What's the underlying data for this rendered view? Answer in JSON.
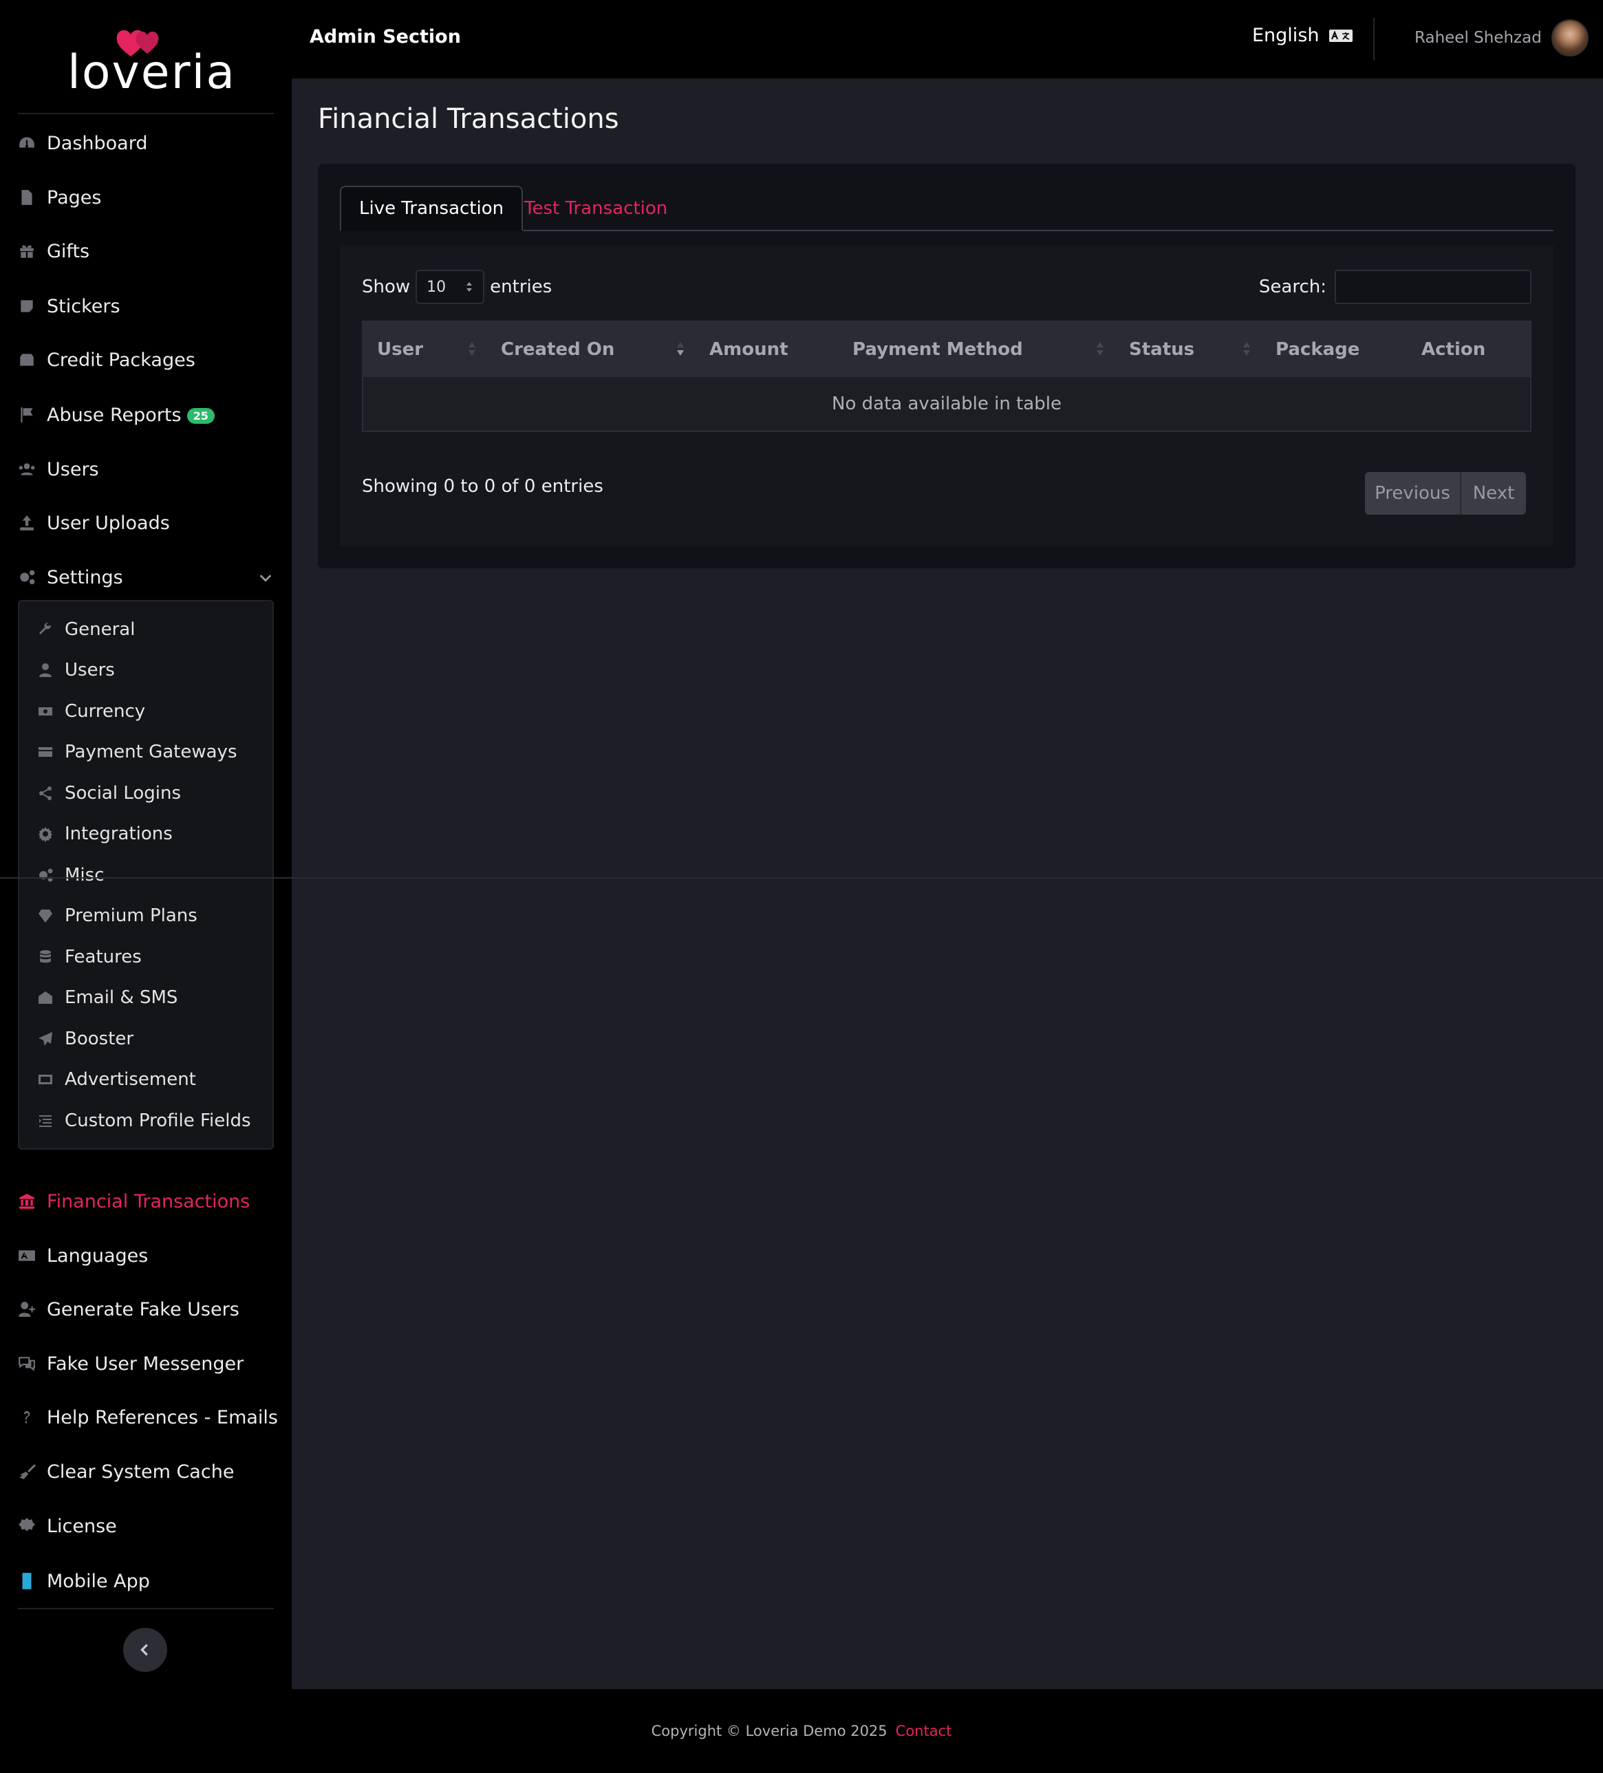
{
  "brand": {
    "name": "loveria"
  },
  "header": {
    "title": "Admin Section",
    "language": "English",
    "user_name": "Raheel Shehzad"
  },
  "sidebar": {
    "items": [
      {
        "label": "Dashboard",
        "icon": "dashboard-icon"
      },
      {
        "label": "Pages",
        "icon": "file-icon"
      },
      {
        "label": "Gifts",
        "icon": "gift-icon"
      },
      {
        "label": "Stickers",
        "icon": "sticky-note-icon"
      },
      {
        "label": "Credit Packages",
        "icon": "box-icon"
      },
      {
        "label": "Abuse Reports",
        "icon": "flag-icon",
        "badge": "25"
      },
      {
        "label": "Users",
        "icon": "users-icon"
      },
      {
        "label": "User Uploads",
        "icon": "upload-icon"
      },
      {
        "label": "Settings",
        "icon": "cogs-icon"
      }
    ],
    "settings_items": [
      {
        "label": "General",
        "icon": "wrench-icon"
      },
      {
        "label": "Users",
        "icon": "user-icon"
      },
      {
        "label": "Currency",
        "icon": "money-icon"
      },
      {
        "label": "Payment Gateways",
        "icon": "credit-card-icon"
      },
      {
        "label": "Social Logins",
        "icon": "share-icon"
      },
      {
        "label": "Integrations",
        "icon": "gear-icon"
      },
      {
        "label": "Misc",
        "icon": "cogs-icon"
      },
      {
        "label": "Premium Plans",
        "icon": "diamond-icon"
      },
      {
        "label": "Features",
        "icon": "database-icon"
      },
      {
        "label": "Email & SMS",
        "icon": "envelope-open-icon"
      },
      {
        "label": "Booster",
        "icon": "paper-plane-icon"
      },
      {
        "label": "Advertisement",
        "icon": "ad-icon"
      },
      {
        "label": "Custom Profile Fields",
        "icon": "list-icon"
      }
    ],
    "bottom_items": [
      {
        "label": "Financial Transactions",
        "icon": "bank-icon",
        "active": true
      },
      {
        "label": "Languages",
        "icon": "language-icon"
      },
      {
        "label": "Generate Fake Users",
        "icon": "user-plus-icon"
      },
      {
        "label": "Fake User Messenger",
        "icon": "comments-icon"
      },
      {
        "label": "Help References - Emails",
        "icon": "question-icon"
      },
      {
        "label": "Clear System Cache",
        "icon": "broom-icon"
      },
      {
        "label": "License",
        "icon": "certificate-icon"
      },
      {
        "label": "Mobile App",
        "icon": "mobile-icon"
      }
    ]
  },
  "main": {
    "title": "Financial Transactions",
    "tabs": [
      {
        "label": "Live Transaction",
        "active": true
      },
      {
        "label": "Test Transaction",
        "active": false
      }
    ],
    "show_label": "Show",
    "entries_value": "10",
    "entries_label": "entries",
    "search_label": "Search:",
    "columns": [
      "User",
      "Created On",
      "Amount",
      "Payment Method",
      "Status",
      "Package",
      "Action"
    ],
    "empty_message": "No data available in table",
    "info": "Showing 0 to 0 of 0 entries",
    "pager": {
      "previous": "Previous",
      "next": "Next"
    }
  },
  "footer": {
    "copyright": "Copyright © Loveria Demo 2025",
    "contact": "Contact"
  },
  "colors": {
    "accent": "#e4245d",
    "badge": "#2bbb6a"
  }
}
